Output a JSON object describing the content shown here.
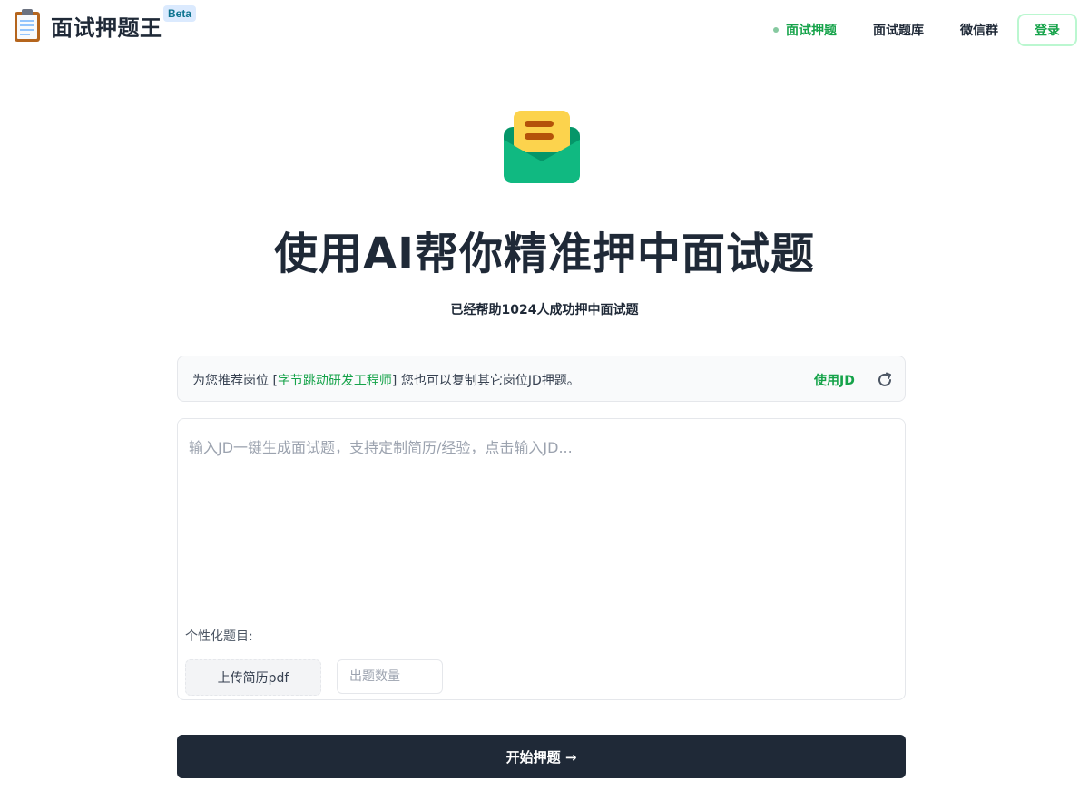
{
  "header": {
    "app_title": "面试押题王",
    "beta_badge": "Beta",
    "nav": [
      {
        "label": "面试押题"
      },
      {
        "label": "面试题库"
      },
      {
        "label": "微信群"
      }
    ],
    "login_label": "登录"
  },
  "hero": {
    "title": "使用AI帮你精准押中面试题",
    "subtitle": "已经帮助1024人成功押中面试题"
  },
  "recommend": {
    "prefix": "为您推荐岗位 [",
    "job": "字节跳动研发工程师",
    "suffix": "] 您也可以复制其它岗位JD押题。",
    "use_jd_label": "使用JD"
  },
  "form": {
    "jd_placeholder": "输入JD一键生成面试题，支持定制简历/经验，点击输入JD...",
    "persona_label": "个性化题目:",
    "upload_label": "上传简历pdf",
    "count_placeholder": "出题数量"
  },
  "start_label": "开始押题 →",
  "colors": {
    "accent": "#16a34a",
    "dark": "#1f2937"
  }
}
